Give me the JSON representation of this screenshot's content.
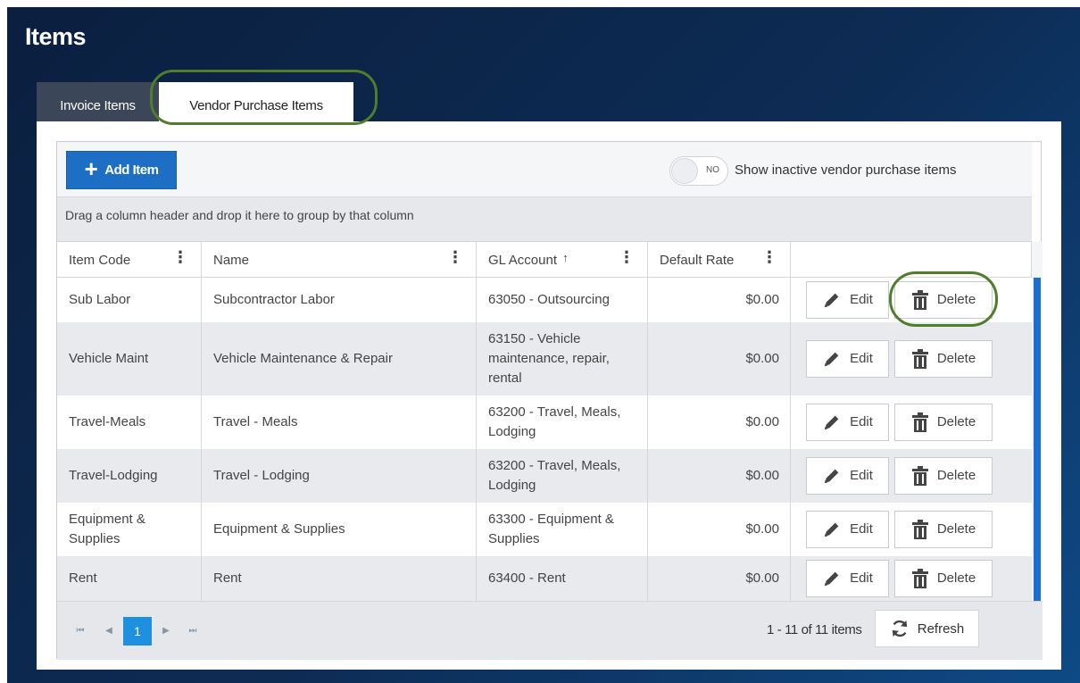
{
  "page": {
    "title": "Items"
  },
  "tabs": [
    {
      "label": "Invoice Items",
      "active": false
    },
    {
      "label": "Vendor Purchase Items",
      "active": true
    }
  ],
  "toolbar": {
    "add_label": "Add Item",
    "toggle_state": "NO",
    "toggle_label": "Show inactive vendor purchase items"
  },
  "group_hint": "Drag a column header and drop it here to group by that column",
  "columns": [
    "Item Code",
    "Name",
    "GL Account",
    "Default Rate"
  ],
  "sorted_column_arrow": "↑",
  "rows": [
    {
      "code": "Sub Labor",
      "name": "Subcontractor Labor",
      "gl": "63050 - Outsourcing",
      "rate": "$0.00"
    },
    {
      "code": "Vehicle Maint",
      "name": "Vehicle Maintenance & Repair",
      "gl": "63150 - Vehicle maintenance, repair, rental",
      "rate": "$0.00"
    },
    {
      "code": "Travel-Meals",
      "name": "Travel - Meals",
      "gl": "63200 - Travel, Meals, Lodging",
      "rate": "$0.00"
    },
    {
      "code": "Travel-Lodging",
      "name": "Travel - Lodging",
      "gl": "63200 - Travel, Meals, Lodging",
      "rate": "$0.00"
    },
    {
      "code": "Equipment & Supplies",
      "name": "Equipment & Supplies",
      "gl": "63300 - Equipment & Supplies",
      "rate": "$0.00"
    },
    {
      "code": "Rent",
      "name": "Rent",
      "gl": "63400 - Rent",
      "rate": "$0.00"
    }
  ],
  "row_actions": {
    "edit_label": "Edit",
    "delete_label": "Delete"
  },
  "pager": {
    "current_page": "1",
    "info": "1 - 11 of 11 items",
    "refresh_label": "Refresh"
  },
  "icons": {
    "add": "plus-icon",
    "edit": "pencil-icon",
    "delete": "trash-icon",
    "refresh": "refresh-icon",
    "column_menu": "kebab-menu-icon"
  },
  "colors": {
    "primary": "#1c6fc4",
    "highlight": "#4f7d2a",
    "page_current": "#1f8fe0"
  }
}
